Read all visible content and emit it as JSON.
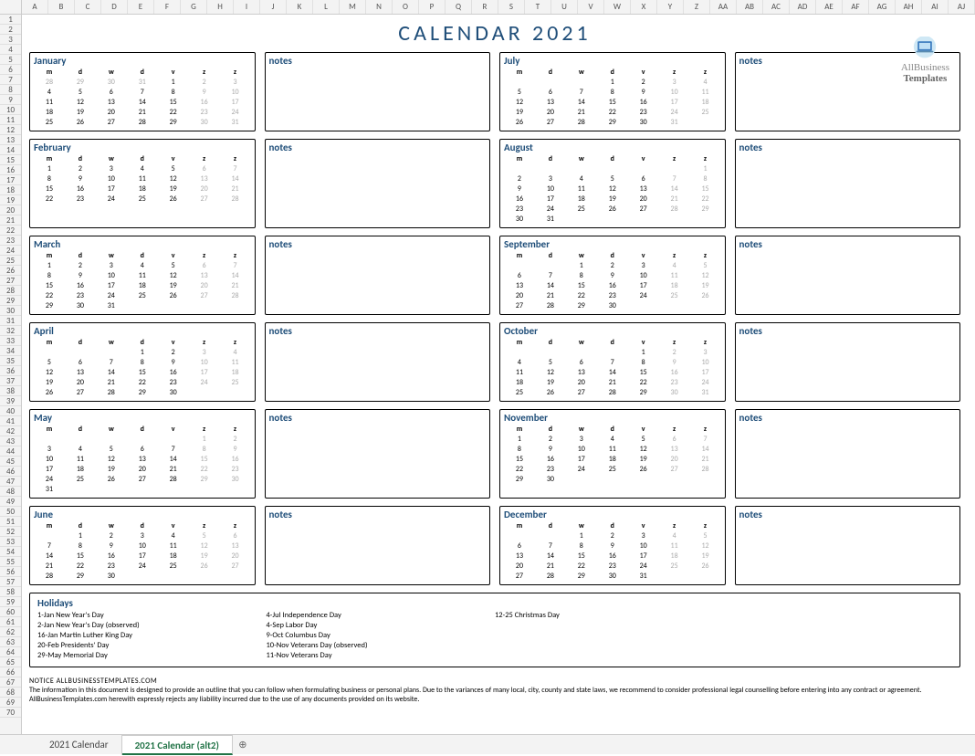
{
  "title": "CALENDAR 2021",
  "watermark": {
    "line1": "AllBusiness",
    "line2": "Templates"
  },
  "col_letters": [
    "A",
    "B",
    "C",
    "D",
    "E",
    "F",
    "G",
    "H",
    "I",
    "J",
    "K",
    "L",
    "M",
    "N",
    "O",
    "P",
    "Q",
    "R",
    "S",
    "T",
    "U",
    "V",
    "W",
    "X",
    "Y",
    "Z",
    "AA",
    "AB",
    "AC",
    "AD",
    "AE",
    "AF",
    "AG",
    "AH",
    "AI",
    "AJ"
  ],
  "day_headers": [
    "m",
    "d",
    "w",
    "d",
    "v",
    "z",
    "z"
  ],
  "notes_label": "notes",
  "months": [
    {
      "name": "January",
      "cells": [
        28,
        29,
        30,
        31,
        1,
        2,
        3,
        4,
        5,
        6,
        7,
        8,
        9,
        10,
        11,
        12,
        13,
        14,
        15,
        16,
        17,
        18,
        19,
        20,
        21,
        22,
        23,
        24,
        25,
        26,
        27,
        28,
        29,
        30,
        31,
        "",
        "",
        "",
        "",
        "",
        "",
        ""
      ],
      "muted_before": 4,
      "muted_after": 35
    },
    {
      "name": "February",
      "cells": [
        1,
        2,
        3,
        4,
        5,
        6,
        7,
        8,
        9,
        10,
        11,
        12,
        13,
        14,
        15,
        16,
        17,
        18,
        19,
        20,
        21,
        22,
        23,
        24,
        25,
        26,
        27,
        28,
        "",
        "",
        "",
        "",
        "",
        "",
        "",
        "",
        "",
        "",
        "",
        "",
        "",
        ""
      ],
      "muted_before": 0,
      "muted_after": 28
    },
    {
      "name": "March",
      "cells": [
        1,
        2,
        3,
        4,
        5,
        6,
        7,
        8,
        9,
        10,
        11,
        12,
        13,
        14,
        15,
        16,
        17,
        18,
        19,
        20,
        21,
        22,
        23,
        24,
        25,
        26,
        27,
        28,
        29,
        30,
        31,
        "",
        "",
        "",
        "",
        "",
        "",
        "",
        "",
        "",
        "",
        ""
      ],
      "muted_before": 0,
      "muted_after": 31
    },
    {
      "name": "April",
      "cells": [
        "",
        "",
        "",
        1,
        2,
        3,
        4,
        5,
        6,
        7,
        8,
        9,
        10,
        11,
        12,
        13,
        14,
        15,
        16,
        17,
        18,
        19,
        20,
        21,
        22,
        23,
        24,
        25,
        26,
        27,
        28,
        29,
        30,
        "",
        "",
        "",
        "",
        "",
        "",
        "",
        "",
        ""
      ],
      "muted_before": 3,
      "muted_after": 33
    },
    {
      "name": "May",
      "cells": [
        "",
        "",
        "",
        "",
        "",
        1,
        2,
        3,
        4,
        5,
        6,
        7,
        8,
        9,
        10,
        11,
        12,
        13,
        14,
        15,
        16,
        17,
        18,
        19,
        20,
        21,
        22,
        23,
        24,
        25,
        26,
        27,
        28,
        29,
        30,
        31,
        "",
        "",
        "",
        "",
        "",
        ""
      ],
      "muted_before": 5,
      "muted_after": 36
    },
    {
      "name": "June",
      "cells": [
        "",
        1,
        2,
        3,
        4,
        5,
        6,
        7,
        8,
        9,
        10,
        11,
        12,
        13,
        14,
        15,
        16,
        17,
        18,
        19,
        20,
        21,
        22,
        23,
        24,
        25,
        26,
        27,
        28,
        29,
        30,
        "",
        "",
        "",
        "",
        "",
        "",
        "",
        "",
        "",
        "",
        ""
      ],
      "muted_before": 1,
      "muted_after": 31
    },
    {
      "name": "July",
      "cells": [
        "",
        "",
        "",
        1,
        2,
        3,
        4,
        5,
        6,
        7,
        8,
        9,
        10,
        11,
        12,
        13,
        14,
        15,
        16,
        17,
        18,
        19,
        20,
        21,
        22,
        23,
        24,
        25,
        26,
        27,
        28,
        29,
        30,
        31,
        "",
        "",
        "",
        "",
        "",
        "",
        "",
        ""
      ],
      "muted_before": 3,
      "muted_after": 34
    },
    {
      "name": "August",
      "cells": [
        "",
        "",
        "",
        "",
        "",
        "",
        1,
        2,
        3,
        4,
        5,
        6,
        7,
        8,
        9,
        10,
        11,
        12,
        13,
        14,
        15,
        16,
        17,
        18,
        19,
        20,
        21,
        22,
        23,
        24,
        25,
        26,
        27,
        28,
        29,
        30,
        31,
        "",
        "",
        "",
        "",
        ""
      ],
      "muted_before": 6,
      "muted_after": 37
    },
    {
      "name": "September",
      "cells": [
        "",
        "",
        1,
        2,
        3,
        4,
        5,
        6,
        7,
        8,
        9,
        10,
        11,
        12,
        13,
        14,
        15,
        16,
        17,
        18,
        19,
        20,
        21,
        22,
        23,
        24,
        25,
        26,
        27,
        28,
        29,
        30,
        "",
        "",
        "",
        "",
        "",
        "",
        "",
        "",
        "",
        ""
      ],
      "muted_before": 2,
      "muted_after": 32
    },
    {
      "name": "October",
      "cells": [
        "",
        "",
        "",
        "",
        1,
        2,
        3,
        4,
        5,
        6,
        7,
        8,
        9,
        10,
        11,
        12,
        13,
        14,
        15,
        16,
        17,
        18,
        19,
        20,
        21,
        22,
        23,
        24,
        25,
        26,
        27,
        28,
        29,
        30,
        31,
        "",
        "",
        "",
        "",
        "",
        "",
        ""
      ],
      "muted_before": 4,
      "muted_after": 35
    },
    {
      "name": "November",
      "cells": [
        1,
        2,
        3,
        4,
        5,
        6,
        7,
        8,
        9,
        10,
        11,
        12,
        13,
        14,
        15,
        16,
        17,
        18,
        19,
        20,
        21,
        22,
        23,
        24,
        25,
        26,
        27,
        28,
        29,
        30,
        "",
        "",
        "",
        "",
        "",
        "",
        "",
        "",
        "",
        "",
        "",
        ""
      ],
      "muted_before": 0,
      "muted_after": 30
    },
    {
      "name": "December",
      "cells": [
        "",
        "",
        1,
        2,
        3,
        4,
        5,
        6,
        7,
        8,
        9,
        10,
        11,
        12,
        13,
        14,
        15,
        16,
        17,
        18,
        19,
        20,
        21,
        22,
        23,
        24,
        25,
        26,
        27,
        28,
        29,
        30,
        31,
        "",
        "",
        "",
        "",
        "",
        "",
        "",
        "",
        ""
      ],
      "muted_before": 2,
      "muted_after": 33
    }
  ],
  "weekend_cols": [
    5,
    6
  ],
  "holidays": {
    "title": "Holidays",
    "col1": [
      "1-Jan  New Year's Day",
      "2-Jan  New Year's Day (observed)",
      "16-Jan  Martin Luther King Day",
      "20-Feb  Presidents' Day",
      "29-May  Memorial Day"
    ],
    "col2": [
      "4-Jul  Independence Day",
      "4-Sep  Labor Day",
      "9-Oct  Columbus Day",
      "10-Nov  Veterans Day (observed)",
      "11-Nov  Veterans Day"
    ],
    "col3": [
      "12-25  Christmas Day"
    ],
    "col4": []
  },
  "notice": {
    "heading": "NOTICE ALLBUSINESSTEMPLATES.COM",
    "body": "The information in this document is designed to provide an outline that you can follow when formulating business or personal plans. Due to the variances of many local, city, county and state laws, we recommend to consider professional legal counselling before entering into any contract or agreement. AllBusinessTemplates.com herewith expressly rejects any liability incurred due to the use of any documents provided on its website."
  },
  "tabs": {
    "tab1": "2021 Calendar",
    "tab2": "2021 Calendar (alt2)"
  }
}
